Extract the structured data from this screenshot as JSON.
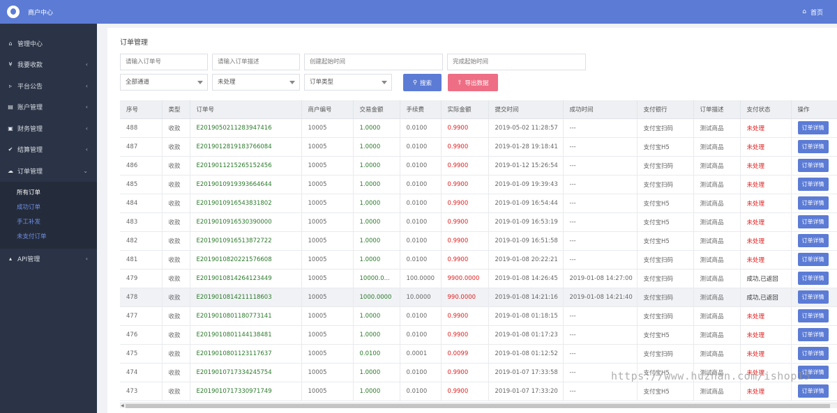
{
  "header": {
    "title": "商户中心",
    "home_label": "首页"
  },
  "sidebar": {
    "items": [
      {
        "label": "管理中心",
        "icon": "home-icon"
      },
      {
        "label": "我要收款",
        "icon": "rmb-icon"
      },
      {
        "label": "平台公告",
        "icon": "bullhorn-icon"
      },
      {
        "label": "账户管理",
        "icon": "card-icon"
      },
      {
        "label": "财务管理",
        "icon": "money-icon"
      },
      {
        "label": "结算管理",
        "icon": "check-icon"
      },
      {
        "label": "订单管理",
        "icon": "cloud-icon"
      },
      {
        "label": "API管理",
        "icon": "bank-icon"
      }
    ],
    "submenu": [
      "所有订单",
      "成功订单",
      "手工补发",
      "未支付订单"
    ]
  },
  "page": {
    "title": "订单管理"
  },
  "filters": {
    "order_no_placeholder": "请输入订单号",
    "order_desc_placeholder": "请输入订单描述",
    "create_time_placeholder": "创建起始时间",
    "finish_time_placeholder": "完成起始时间",
    "channel": "全部通道",
    "status": "未处理",
    "order_type": "订单类型",
    "search_label": "搜索",
    "export_label": "导出数据"
  },
  "table": {
    "columns": [
      "序号",
      "类型",
      "订单号",
      "商户编号",
      "交易金额",
      "手续费",
      "实际金额",
      "提交时间",
      "成功时间",
      "支付银行",
      "订单描述",
      "支付状态",
      "操作"
    ],
    "action_label": "订单详情",
    "rows": [
      [
        "488",
        "收款",
        "E20190502112839474​16",
        "10005",
        "1.0000",
        "0.0100",
        "0.9900",
        "2019-05-02 11:28:57",
        "---",
        "支付宝扫码",
        "测试商品",
        "未处理"
      ],
      [
        "487",
        "收款",
        "E20190128191837660​84",
        "10005",
        "1.0000",
        "0.0100",
        "0.9900",
        "2019-01-28 19:18:41",
        "---",
        "支付宝H5",
        "测试商品",
        "未处理"
      ],
      [
        "486",
        "收款",
        "E20190112152651524​56",
        "10005",
        "1.0000",
        "0.0100",
        "0.9900",
        "2019-01-12 15:26:54",
        "---",
        "支付宝扫码",
        "测试商品",
        "未处理"
      ],
      [
        "485",
        "收款",
        "E20190109193936646​44",
        "10005",
        "1.0000",
        "0.0100",
        "0.9900",
        "2019-01-09 19:39:43",
        "---",
        "支付宝扫码",
        "测试商品",
        "未处理"
      ],
      [
        "484",
        "收款",
        "E20190109165438318​02",
        "10005",
        "1.0000",
        "0.0100",
        "0.9900",
        "2019-01-09 16:54:44",
        "---",
        "支付宝H5",
        "测试商品",
        "未处理"
      ],
      [
        "483",
        "收款",
        "E20190109165303900​00",
        "10005",
        "1.0000",
        "0.0100",
        "0.9900",
        "2019-01-09 16:53:19",
        "---",
        "支付宝H5",
        "测试商品",
        "未处理"
      ],
      [
        "482",
        "收款",
        "E20190109165138727​22",
        "10005",
        "1.0000",
        "0.0100",
        "0.9900",
        "2019-01-09 16:51:58",
        "---",
        "支付宝H5",
        "测试商品",
        "未处理"
      ],
      [
        "481",
        "收款",
        "E20190108202215766​08",
        "10005",
        "1.0000",
        "0.0100",
        "0.9900",
        "2019-01-08 20:22:21",
        "---",
        "支付宝扫码",
        "测试商品",
        "未处理"
      ],
      [
        "479",
        "收款",
        "E20190108142641234​49",
        "10005",
        "10000.0...",
        "100.0000",
        "9900.0000",
        "2019-01-08 14:26:45",
        "2019-01-08 14:27:00",
        "支付宝扫码",
        "测试商品",
        "成功,已返回"
      ],
      [
        "478",
        "收款",
        "E20190108142111186​03",
        "10005",
        "1000.0000",
        "10.0000",
        "990.0000",
        "2019-01-08 14:21:16",
        "2019-01-08 14:21:40",
        "支付宝扫码",
        "测试商品",
        "成功,已返回"
      ],
      [
        "477",
        "收款",
        "E20190108011807731​41",
        "10005",
        "1.0000",
        "0.0100",
        "0.9900",
        "2019-01-08 01:18:15",
        "---",
        "支付宝扫码",
        "测试商品",
        "未处理"
      ],
      [
        "476",
        "收款",
        "E20190108011441384​81",
        "10005",
        "1.0000",
        "0.0100",
        "0.9900",
        "2019-01-08 01:17:23",
        "---",
        "支付宝H5",
        "测试商品",
        "未处理"
      ],
      [
        "475",
        "收款",
        "E20190108011231176​37",
        "10005",
        "0.0100",
        "0.0001",
        "0.0099",
        "2019-01-08 01:12:52",
        "---",
        "支付宝扫码",
        "测试商品",
        "未处理"
      ],
      [
        "474",
        "收款",
        "E20190107173342457​54",
        "10005",
        "1.0000",
        "0.0100",
        "0.9900",
        "2019-01-07 17:33:58",
        "---",
        "支付宝H5",
        "测试商品",
        "未处理"
      ],
      [
        "473",
        "收款",
        "E20190107173309717​49",
        "10005",
        "1.0000",
        "0.0100",
        "0.9900",
        "2019-01-07 17:33:20",
        "---",
        "支付宝H5",
        "测试商品",
        "未处理"
      ]
    ]
  },
  "watermark": "https://www.huzhan.com/ishop15",
  "colors": {
    "primary": "#5b7bd5",
    "export": "#ee6e85",
    "sidebar": "#2b3446",
    "amount_green": "#2a7a2a",
    "status_red": "#e02020"
  }
}
